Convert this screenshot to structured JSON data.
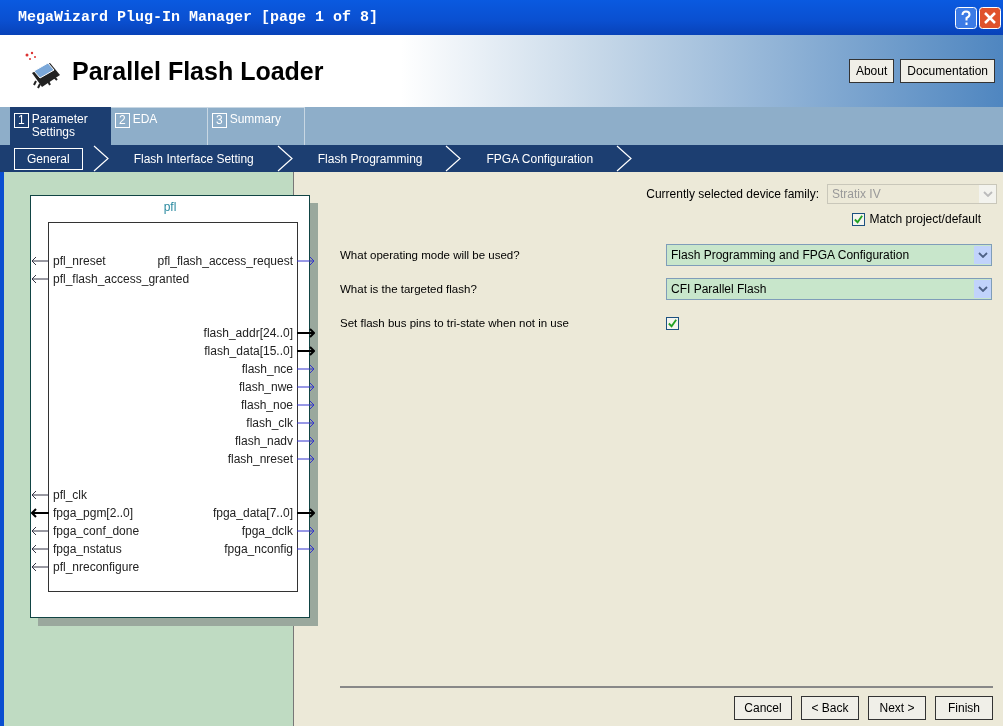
{
  "window": {
    "title": "MegaWizard Plug-In Manager [page 1 of 8]"
  },
  "header": {
    "title": "Parallel Flash Loader",
    "buttons": [
      "About",
      "Documentation"
    ]
  },
  "tabs": [
    {
      "number": "1",
      "label": "Parameter Settings",
      "selected": true
    },
    {
      "number": "2",
      "label": "EDA",
      "selected": false
    },
    {
      "number": "3",
      "label": "Summary",
      "selected": false
    }
  ],
  "steps": [
    {
      "label": "General",
      "selected": true
    },
    {
      "label": "Flash Interface Setting",
      "selected": false
    },
    {
      "label": "Flash Programming",
      "selected": false
    },
    {
      "label": "FPGA Configuration",
      "selected": false
    }
  ],
  "symbol": {
    "name": "pfl",
    "left_groups": [
      [
        {
          "name": "pfl_nreset",
          "bus": false
        },
        {
          "name": "pfl_flash_access_granted",
          "bus": false
        }
      ],
      [
        {
          "name": "pfl_clk",
          "bus": false
        },
        {
          "name": "fpga_pgm[2..0]",
          "bus": true
        },
        {
          "name": "fpga_conf_done",
          "bus": false
        },
        {
          "name": "fpga_nstatus",
          "bus": false
        },
        {
          "name": "pfl_nreconfigure",
          "bus": false
        }
      ]
    ],
    "right_groups": [
      [
        {
          "name": "pfl_flash_access_request",
          "bus": false
        }
      ],
      [
        {
          "name": "flash_addr[24..0]",
          "bus": true
        },
        {
          "name": "flash_data[15..0]",
          "bus": true
        },
        {
          "name": "flash_nce",
          "bus": false
        },
        {
          "name": "flash_nwe",
          "bus": false
        },
        {
          "name": "flash_noe",
          "bus": false
        },
        {
          "name": "flash_clk",
          "bus": false
        },
        {
          "name": "flash_nadv",
          "bus": false
        },
        {
          "name": "flash_nreset",
          "bus": false
        }
      ],
      [
        {
          "name": "fpga_data[7..0]",
          "bus": true
        },
        {
          "name": "fpga_dclk",
          "bus": false
        },
        {
          "name": "fpga_nconfig",
          "bus": false
        }
      ]
    ]
  },
  "device_family": {
    "label": "Currently selected device family:",
    "value": "Stratix IV",
    "disabled": true
  },
  "match_project": {
    "label": "Match project/default",
    "checked": true
  },
  "options": [
    {
      "kind": "dropdown",
      "label": "What operating mode will be used?",
      "value": "Flash Programming and FPGA Configuration"
    },
    {
      "kind": "dropdown",
      "label": "What is the targeted flash?",
      "value": "CFI Parallel Flash"
    },
    {
      "kind": "checkbox",
      "label": "Set flash bus pins to tri-state when not in use",
      "checked": true
    }
  ],
  "footer_buttons": [
    "Cancel",
    "< Back",
    "Next >",
    "Finish"
  ]
}
